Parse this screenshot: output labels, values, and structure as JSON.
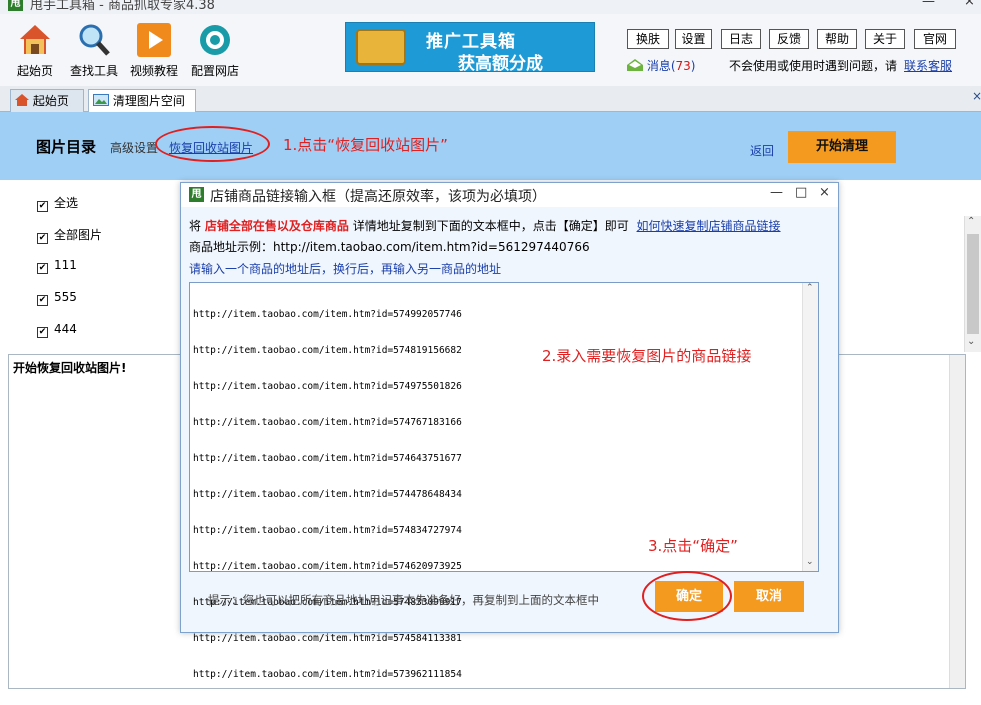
{
  "window": {
    "title": "甩手工具箱 - 商品抓取专家4.38",
    "app_icon": "甩",
    "minimize": "—",
    "close": "×"
  },
  "toolbar": {
    "tools": [
      {
        "label": "起始页",
        "icon": "home-icon"
      },
      {
        "label": "查找工具",
        "icon": "search-icon"
      },
      {
        "label": "视频教程",
        "icon": "play-icon"
      },
      {
        "label": "配置网店",
        "icon": "gear-icon"
      }
    ],
    "banner": {
      "line1": "推广工具箱",
      "line2": "获高额分成"
    },
    "buttons": [
      "换肤",
      "设置",
      "日志",
      "反馈",
      "帮助",
      "关于",
      "官网"
    ],
    "messages_label": "消息(",
    "messages_count": "73",
    "messages_close": ")",
    "notice": "不会使用或使用时遇到问题，请",
    "support_link": "联系客服"
  },
  "tabs": [
    {
      "label": "起始页",
      "icon": "home-icon"
    },
    {
      "label": "清理图片空间",
      "icon": "image-icon"
    }
  ],
  "tabbar_close": "×",
  "header": {
    "title": "图片目录",
    "advanced": "高级设置",
    "restore_link": "恢复回收站图片",
    "annotation1": "1.点击“恢复回收站图片”",
    "back": "返回",
    "start": "开始清理"
  },
  "checklist": [
    "全选",
    "全部图片",
    "111",
    "555",
    "444"
  ],
  "log": {
    "text": "开始恢复回收站图片!"
  },
  "dialog": {
    "icon": "甩",
    "title": "店铺商品链接输入框（提高还原效率，该项为必填项）",
    "min": "—",
    "max": "□",
    "close": "×",
    "line1_a": "将",
    "line1_b": "店铺全部在售以及仓库商品",
    "line1_c": "详情地址复制到下面的文本框中，点击【确定】即可",
    "line1_link": "如何快速复制店铺商品链接",
    "example": "商品地址示例：http://item.taobao.com/item.htm?id=561297440766",
    "instruction": "请输入一个商品的地址后，换行后，再输入另一商品的地址",
    "urls": [
      "http://item.taobao.com/item.htm?id=574992057746",
      "http://item.taobao.com/item.htm?id=574819156682",
      "http://item.taobao.com/item.htm?id=574975501826",
      "http://item.taobao.com/item.htm?id=574767183166",
      "http://item.taobao.com/item.htm?id=574643751677",
      "http://item.taobao.com/item.htm?id=574478648434",
      "http://item.taobao.com/item.htm?id=574834727974",
      "http://item.taobao.com/item.htm?id=574620973925",
      "http://item.taobao.com/item.htm?id=574833099917",
      "http://item.taobao.com/item.htm?id=574584113381",
      "http://item.taobao.com/item.htm?id=573962111854"
    ],
    "annotation2": "2.录入需要恢复图片的商品链接",
    "annotation3": "3.点击“确定”",
    "hint": "提示：您也可以把所有商品地址用记事本先准备好，再复制到上面的文本框中",
    "ok": "确定",
    "cancel": "取消"
  },
  "colors": {
    "accent_orange": "#f49a1e",
    "header_blue": "#9fcff5",
    "annotation_red": "#e02020",
    "link_blue": "#1a3faa"
  }
}
